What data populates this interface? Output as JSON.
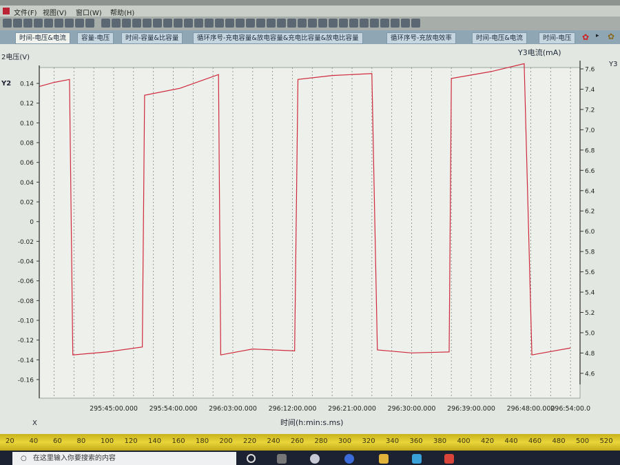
{
  "menu": [
    "文件(F)",
    "视图(V)",
    "窗口(W)",
    "帮助(H)"
  ],
  "tabs": [
    {
      "label": "时间-电压&电流",
      "active": true
    },
    {
      "label": "容量-电压",
      "active": false
    },
    {
      "label": "时间-容量&比容量",
      "active": false
    },
    {
      "label": "循环序号-充电容量&放电容量&充电比容量&放电比容量",
      "active": false
    },
    {
      "label": "循环序号-充放电效率",
      "active": false
    },
    {
      "label": "时间-电压&电流",
      "active": false
    },
    {
      "label": "时间-电压",
      "active": false
    }
  ],
  "ruler_marks": [
    "20",
    "40",
    "60",
    "80",
    "100",
    "120",
    "140",
    "160",
    "180",
    "200",
    "220",
    "240",
    "260",
    "280",
    "300",
    "320",
    "340",
    "360",
    "380",
    "400",
    "420",
    "440",
    "460",
    "480",
    "500",
    "520"
  ],
  "taskbar": {
    "search_placeholder": "在这里输入你要搜索的内容"
  },
  "chart_data": {
    "type": "line",
    "left_axis_title": "2电压(V)",
    "left_axis_name": "Y2",
    "right_axis_title": "Y3电流(mA)",
    "right_axis_name": "Y3",
    "xlabel": "时间(h:min:s.ms)",
    "x_axis_name": "X",
    "x_ticks": [
      "295:45:00.000",
      "295:54:00.000",
      "296:03:00.000",
      "296:12:00.000",
      "296:21:00.000",
      "296:30:00.000",
      "296:39:00.000",
      "296:48:00.000",
      "296:54:00.0"
    ],
    "y_left_ticks": [
      "0.14",
      "0.12",
      "0.10",
      "0.08",
      "0.06",
      "0.04",
      "0.02",
      "0",
      "-0.02",
      "-0.04",
      "-0.06",
      "-0.08",
      "-0.10",
      "-0.12",
      "-0.14",
      "-0.16"
    ],
    "y_right_ticks": [
      "7.6",
      "7.4",
      "7.2",
      "7.0",
      "6.8",
      "6.6",
      "6.4",
      "6.2",
      "6.0",
      "5.8",
      "5.6",
      "5.4",
      "5.2",
      "5.0",
      "4.8",
      "4.6"
    ],
    "ylim_left": [
      -0.175,
      0.155
    ],
    "ylim_right": [
      4.5,
      7.65
    ],
    "grid": "vertical dashed",
    "series_color": "#d0283a",
    "series": [
      {
        "axis": "left",
        "points": [
          [
            "295:33:48",
            0.137
          ],
          [
            "295:36:00",
            0.141
          ],
          [
            "295:38:20",
            0.144
          ],
          [
            "295:38:50",
            -0.135
          ],
          [
            "295:44:00",
            -0.132
          ],
          [
            "295:49:20",
            -0.127
          ],
          [
            "295:49:40",
            0.128
          ],
          [
            "295:55:00",
            0.135
          ],
          [
            "296:00:50",
            0.149
          ],
          [
            "296:01:10",
            -0.135
          ],
          [
            "296:06:00",
            -0.129
          ],
          [
            "296:12:20",
            -0.131
          ],
          [
            "296:12:50",
            0.144
          ],
          [
            "296:18:00",
            0.148
          ],
          [
            "296:24:00",
            0.15
          ],
          [
            "296:24:50",
            -0.13
          ],
          [
            "296:30:00",
            -0.133
          ],
          [
            "296:35:40",
            -0.132
          ],
          [
            "296:36:00",
            0.145
          ],
          [
            "296:42:00",
            0.152
          ],
          [
            "296:47:00",
            0.16
          ],
          [
            "296:48:10",
            -0.135
          ],
          [
            "296:54:00",
            -0.128
          ]
        ]
      }
    ]
  }
}
